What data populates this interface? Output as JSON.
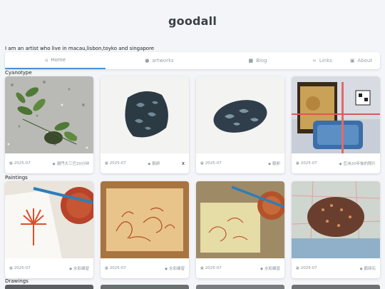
{
  "site": {
    "title": "goodall",
    "tagline": "I am an artist who live in macau,lisbon,toyko and singapore"
  },
  "nav": {
    "items": [
      {
        "label": "Home",
        "icon": "home-icon"
      },
      {
        "label": "artworks",
        "icon": "palette-icon"
      },
      {
        "label": "Blog",
        "icon": "book-icon"
      },
      {
        "label": "Links",
        "icon": "link-icon"
      },
      {
        "label": "About",
        "icon": "id-card-icon"
      }
    ],
    "active": "Home",
    "active_color": "#4a90d9"
  },
  "sections": {
    "cyanotype": {
      "label": "Cyanotype",
      "cards": [
        {
          "date": "2025-07",
          "tag": "澳門大三巴20分钟"
        },
        {
          "date": "2025-07",
          "tag": "鹅卵",
          "close": "x"
        },
        {
          "date": "2025-07",
          "tag": "鹅卵"
        },
        {
          "date": "2025-07",
          "tag": "亞洲20年後的照片"
        }
      ]
    },
    "paintings": {
      "label": "Paintings",
      "cards": [
        {
          "date": "2025-07",
          "tag": "水彩練習"
        },
        {
          "date": "2025-07",
          "tag": "水彩練習"
        },
        {
          "date": "2025-07",
          "tag": "水彩練習"
        },
        {
          "date": "2025-07",
          "tag": "鹅卵石"
        }
      ]
    },
    "drawings": {
      "label": "Drawings"
    }
  }
}
